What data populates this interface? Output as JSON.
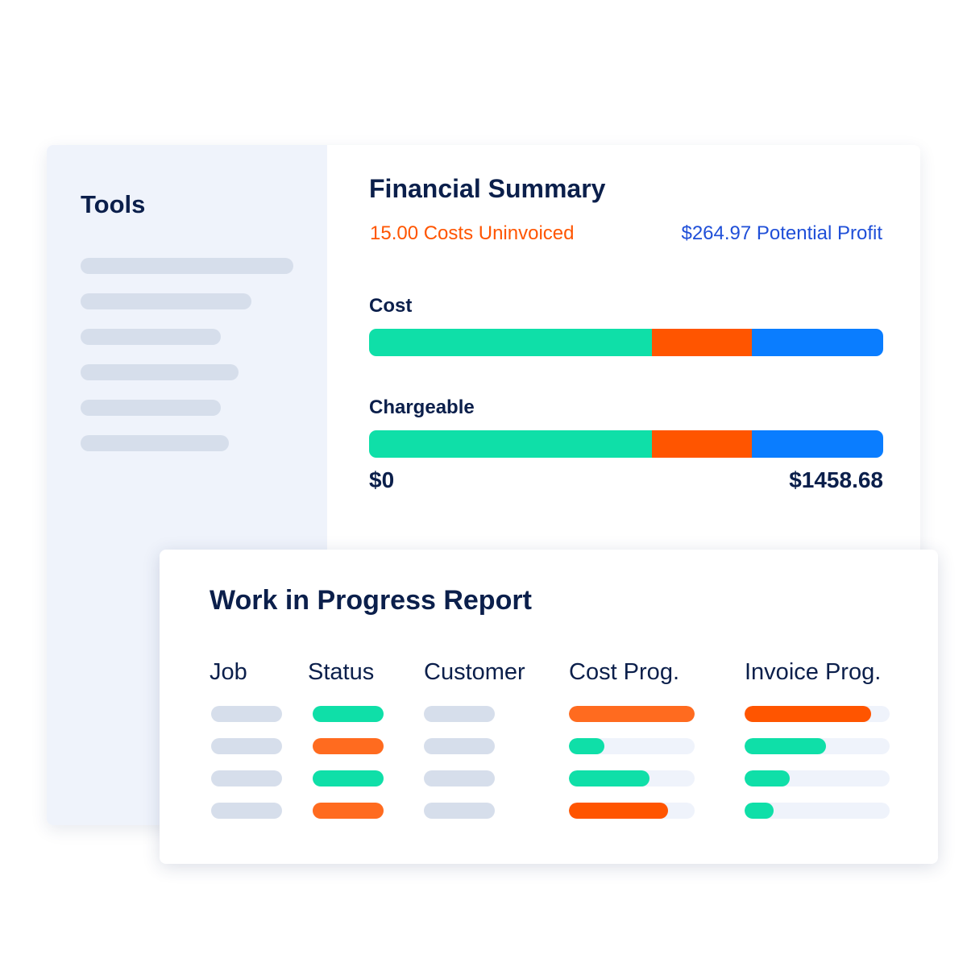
{
  "colors": {
    "green": "#0fdfa8",
    "orange": "#ff5500",
    "orange_light": "#ff6b1f",
    "blue": "#0a7dff",
    "navy": "#0b1f4b",
    "placeholder": "#d6deeb",
    "track": "#eff3fb"
  },
  "sidebar": {
    "title": "Tools",
    "item_count": 6
  },
  "financial_summary": {
    "title": "Financial Summary",
    "costs_uninvoiced": "15.00 Costs Uninvoiced",
    "potential_profit": "$264.97 Potential Profit",
    "bars": [
      {
        "label": "Cost",
        "segments": [
          {
            "color": "green",
            "share": 0.55
          },
          {
            "color": "orange",
            "share": 0.195
          },
          {
            "color": "blue",
            "share": 0.255
          }
        ]
      },
      {
        "label": "Chargeable",
        "segments": [
          {
            "color": "green",
            "share": 0.55
          },
          {
            "color": "orange",
            "share": 0.195
          },
          {
            "color": "blue",
            "share": 0.255
          }
        ]
      }
    ],
    "axis_min": "$0",
    "axis_max": "$1458.68"
  },
  "wip_report": {
    "title": "Work in Progress Report",
    "columns": [
      "Job",
      "Status",
      "Customer",
      "Cost Prog.",
      "Invoice Prog."
    ],
    "rows": [
      {
        "status": "green",
        "cost_progress": 1.0,
        "cost_color": "orange_light",
        "invoice_progress": 0.87,
        "invoice_color": "orange"
      },
      {
        "status": "orange_light",
        "cost_progress": 0.28,
        "cost_color": "green",
        "invoice_progress": 0.56,
        "invoice_color": "green"
      },
      {
        "status": "green",
        "cost_progress": 0.64,
        "cost_color": "green",
        "invoice_progress": 0.31,
        "invoice_color": "green"
      },
      {
        "status": "orange_light",
        "cost_progress": 0.79,
        "cost_color": "orange",
        "invoice_progress": 0.2,
        "invoice_color": "green"
      }
    ]
  }
}
